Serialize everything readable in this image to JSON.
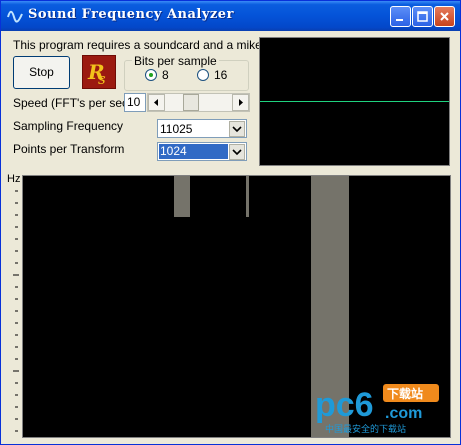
{
  "window": {
    "title": "Sound Frequency Analyzer"
  },
  "controls": {
    "requirement_text": "This program requires a soundcard  and a mike",
    "stop_label": "Stop",
    "bits_group_label": "Bits per sample",
    "bits_options": [
      {
        "label": "8",
        "selected": true
      },
      {
        "label": "16",
        "selected": false
      }
    ],
    "speed_label": "Speed (FFT's per sec)",
    "speed_value": "10",
    "sampling_label": "Sampling Frequency",
    "sampling_value": "11025",
    "points_label": "Points per Transform",
    "points_value": "1024"
  },
  "spectrum": {
    "axis_label": "Hz"
  },
  "watermark": {
    "brand": "pc6",
    "sub": "下载站",
    "domain": ".com",
    "tagline": "中国最安全的下载站"
  },
  "colors": {
    "trace": "#1fd27f",
    "bars": "#75736a",
    "titlebar": "#0453d8",
    "selection": "#316ac5"
  }
}
